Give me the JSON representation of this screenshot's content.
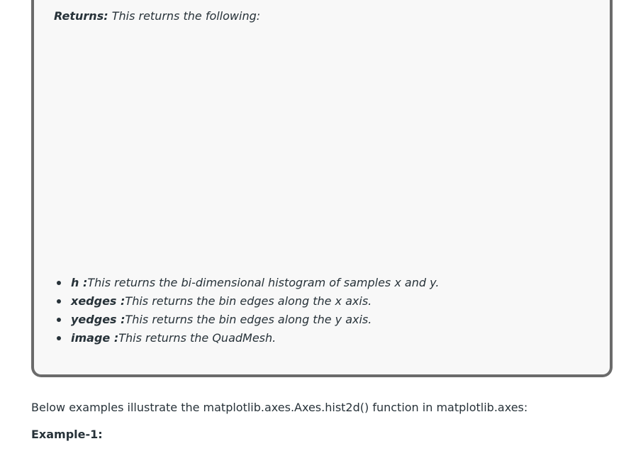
{
  "returns_box": {
    "label": "Returns:",
    "text": " This returns the following:",
    "items": [
      {
        "term": "h :",
        "description": "This returns the bi-dimensional histogram of samples x and y."
      },
      {
        "term": "xedges :",
        "description": "This returns the bin edges along the x axis."
      },
      {
        "term": "yedges :",
        "description": "This returns the bin edges along the y axis."
      },
      {
        "term": "image :",
        "description": "This returns the QuadMesh."
      }
    ]
  },
  "intro": {
    "text": "Below examples illustrate the matplotlib.axes.Axes.hist2d() function in matplotlib.axes:"
  },
  "example": {
    "heading": "Example-1:"
  }
}
